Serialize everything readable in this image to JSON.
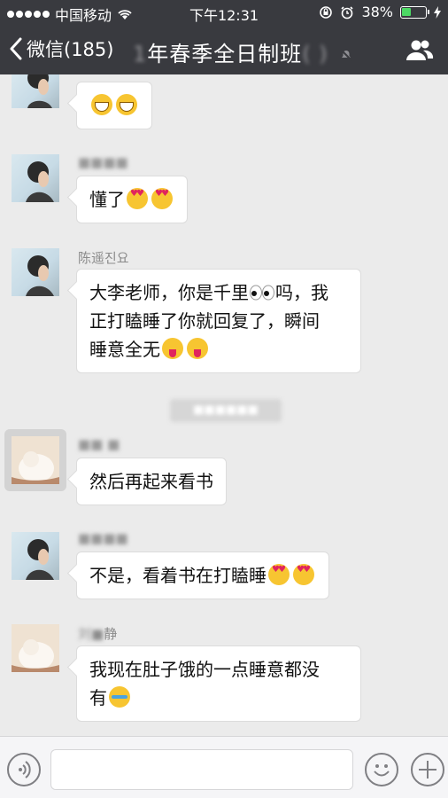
{
  "status_bar": {
    "carrier": "中国移动",
    "time": "下午12:31",
    "battery_percent": "38%",
    "battery_level": 0.38
  },
  "nav": {
    "back_label": "微信(185)",
    "title_visible": "年春季全日制班",
    "title_blurred_prefix": "1",
    "title_blurred_suffix": "(  )"
  },
  "messages": [
    {
      "sender": "",
      "text": "",
      "emojis": [
        "grin",
        "grin"
      ],
      "avatar": "woman-reading-photo"
    },
    {
      "sender": "",
      "text": "懂了",
      "emojis": [
        "heart",
        "heart"
      ],
      "avatar": "woman-reading-photo"
    },
    {
      "sender": "陈遥진요",
      "lines": [
        "大李老师，你是千里",
        "吗，我",
        "正打瞌睡了你就回复了，瞬间",
        "睡意全无"
      ],
      "emojis": [
        "wink",
        "wink"
      ],
      "avatar": "woman-reading-photo"
    },
    {
      "sender": "",
      "text": "然后再起来看书",
      "emojis": [],
      "avatar": "cat-photo"
    },
    {
      "sender": "",
      "text": "不是，看着书在打瞌睡",
      "emojis": [
        "heart",
        "heart"
      ],
      "avatar": "woman-reading-photo"
    },
    {
      "sender": "静",
      "sender_blurred_prefix": "刘",
      "lines": [
        "我现在肚子饿的一点睡意都没",
        "有"
      ],
      "emojis": [
        "laugh"
      ],
      "avatar": "cat-photo"
    }
  ],
  "colors": {
    "bar_bg": "#393a3f",
    "chat_bg": "#ebebeb",
    "bubble_bg": "#ffffff",
    "battery_green": "#4cd964"
  }
}
